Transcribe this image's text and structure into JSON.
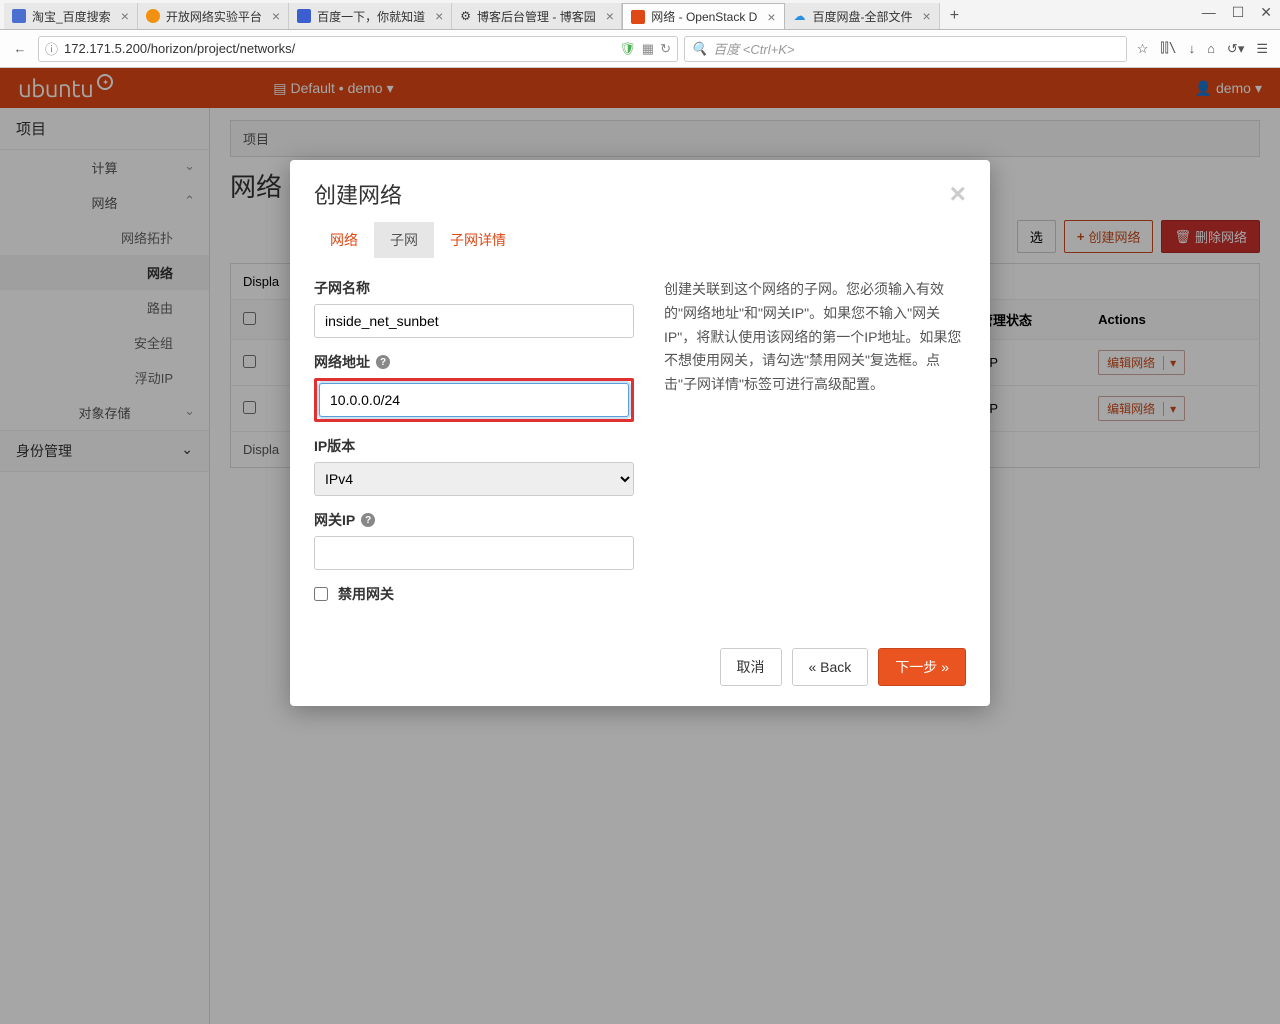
{
  "browser": {
    "tabs": [
      {
        "title": "淘宝_百度搜索",
        "icon_color": "#4a6fd0"
      },
      {
        "title": "开放网络实验平台",
        "icon_color": "#f29111"
      },
      {
        "title": "百度一下，你就知道",
        "icon_color": "#3b5fd0"
      },
      {
        "title": "博客后台管理 - 博客园",
        "icon_color": "#333"
      },
      {
        "title": "网络 - OpenStack D",
        "icon_color": "#dd4814",
        "active": true
      },
      {
        "title": "百度网盘-全部文件",
        "icon_color": "#2a90e0"
      }
    ],
    "url": "172.171.5.200/horizon/project/networks/",
    "search_placeholder": "百度 <Ctrl+K>"
  },
  "header": {
    "brand": "ubuntu",
    "project_selector": "Default • demo",
    "user": "demo"
  },
  "sidebar": {
    "group_project": "项目",
    "item_compute": "计算",
    "item_network": "网络",
    "sub_topology": "网络拓扑",
    "sub_networks": "网络",
    "sub_routers": "路由",
    "sub_secgroups": "安全组",
    "sub_floatingip": "浮动IP",
    "item_objstorage": "对象存储",
    "group_identity": "身份管理"
  },
  "page": {
    "breadcrumb": "项目",
    "title": "网络",
    "filter_btn": "选",
    "create_btn": "创建网络",
    "delete_btn": "删除网络",
    "displaying_top": "Displa",
    "displaying_bottom": "Displa",
    "col_admin_state": "管理状态",
    "col_actions": "Actions",
    "row_action": "编辑网络",
    "rows": [
      {
        "admin_state": "UP"
      },
      {
        "admin_state": "UP"
      }
    ]
  },
  "modal": {
    "title": "创建网络",
    "tabs": {
      "network": "网络",
      "subnet": "子网",
      "detail": "子网详情"
    },
    "labels": {
      "subnet_name": "子网名称",
      "network_address": "网络地址",
      "ip_version": "IP版本",
      "gateway_ip": "网关IP",
      "disable_gateway": "禁用网关"
    },
    "values": {
      "subnet_name": "inside_net_sunbet",
      "network_address": "10.0.0.0/24",
      "ip_version": "IPv4",
      "gateway_ip": ""
    },
    "help_text": "创建关联到这个网络的子网。您必须输入有效的\"网络地址\"和\"网关IP\"。如果您不输入\"网关IP\"，将默认使用该网络的第一个IP地址。如果您不想使用网关，请勾选\"禁用网关\"复选框。点击\"子网详情\"标签可进行高级配置。",
    "footer": {
      "cancel": "取消",
      "back": "«  Back",
      "next": "下一步 »"
    }
  }
}
